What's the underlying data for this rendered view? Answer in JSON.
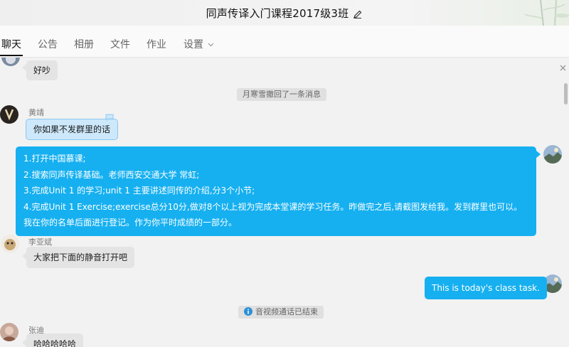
{
  "window": {
    "title": "同声传译入门课程2017级3班"
  },
  "tabs": [
    {
      "label": "聊天",
      "active": true
    },
    {
      "label": "公告"
    },
    {
      "label": "相册"
    },
    {
      "label": "文件"
    },
    {
      "label": "作业"
    },
    {
      "label": "设置"
    }
  ],
  "messages": {
    "m1": {
      "text": "好吵"
    },
    "sys1": {
      "text": "月寒雪撤回了一条消息"
    },
    "m2": {
      "sender": "黄靖",
      "text": "你如果不发群里的话"
    },
    "m3": {
      "lines": [
        "1.打开中国慕课;",
        "2.搜索同声传译基础。老师西安交通大学 常虹;",
        "3.完成Unit 1 的学习;unit 1 主要讲述同传的介绍,分3个小节;",
        "4.完成Unit 1 Exercise;exercise总分10分,做对8个以上视为完成本堂课的学习任务。昨做完之后,请截图发给我。发到群里也可以。我在你的名单后面进行登记。作为你平时成绩的一部分。"
      ]
    },
    "m4": {
      "sender": "李亚斌",
      "text": "大家把下面的静音打开吧"
    },
    "m5": {
      "text": "This is today's class task."
    },
    "sys2": {
      "text": "音视频通话已结束"
    },
    "m6": {
      "sender": "张迪",
      "text": "哈哈哈哈哈"
    }
  },
  "colors": {
    "accent_blue": "#16b0f0",
    "bubble_gray": "#e4e4e4",
    "bubble_light_blue": "#cde8fb"
  },
  "icons": [
    "edit-icon",
    "chevron-down-icon",
    "close-icon",
    "info-icon"
  ]
}
